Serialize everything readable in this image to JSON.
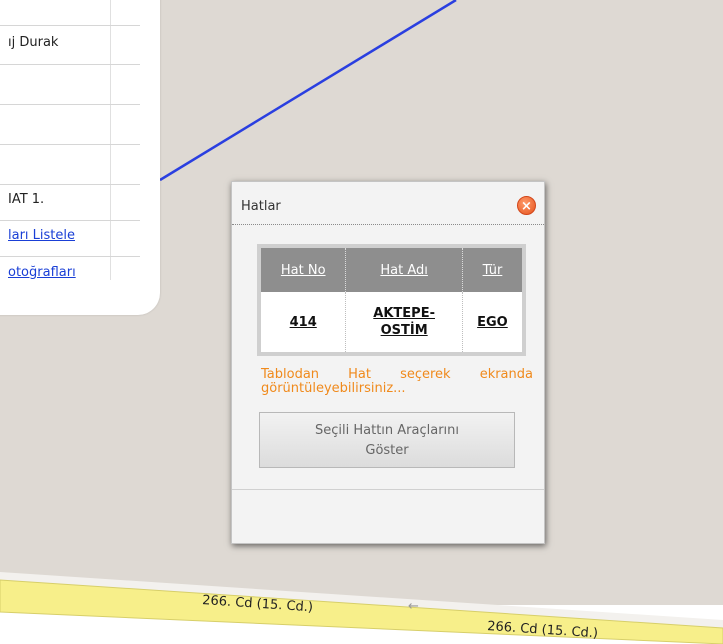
{
  "side_panel": {
    "row1_text": "ıj Durak",
    "row2_text": "",
    "row3_text": "",
    "row4_text": "IAT 1.",
    "link_list": "ları Listele",
    "link_photos": "otoğrafları"
  },
  "popup": {
    "title": "Hatlar",
    "close_icon": "close-icon",
    "table": {
      "headers": [
        "Hat No",
        "Hat Adı",
        "Tür"
      ],
      "rows": [
        [
          "414",
          "AKTEPE-OSTİM",
          "EGO"
        ]
      ],
      "name_line1": "AKTEPE-",
      "name_line2": "OSTİM"
    },
    "hint": "Tablodan Hat seçerek ekranda görüntüleyebilirsiniz...",
    "button_line1": "Seçili Hattın Araçlarını",
    "button_line2": "Göster"
  },
  "map": {
    "road_label_1": "266. Cd (15. Cd.)",
    "road_label_2": "266. Cd (15. Cd.)",
    "arrow": "←",
    "route_color": "#2a3fe0",
    "road_color": "#f7ef8a"
  }
}
